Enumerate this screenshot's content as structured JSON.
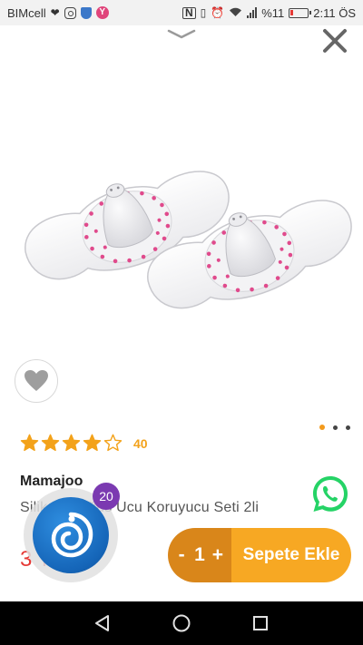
{
  "status_bar": {
    "carrier": "BIMcell",
    "battery_percent": "%11",
    "time": "2:11 ÖS",
    "icons": [
      "heart-icon",
      "instagram-icon",
      "shield-icon",
      "yandex-icon",
      "nfc-icon",
      "vibrate-icon",
      "alarm-icon",
      "wifi-icon",
      "signal-icon",
      "battery-icon"
    ]
  },
  "product": {
    "brand": "Mamajoo",
    "name": "Silikon Göğüs Ucu Koruyucu Seti 2li",
    "price": "3 TL",
    "rating": 4,
    "rating_max": 5,
    "review_count": "40",
    "image_count": 3,
    "active_image": 0
  },
  "chat": {
    "badge_count": "20"
  },
  "cart": {
    "minus_label": "-",
    "quantity": "1",
    "plus_label": "+",
    "add_label": "Sepete Ekle"
  },
  "colors": {
    "accent": "#f7a823",
    "accent_dark": "#d9861a",
    "price": "#e53935",
    "star": "#f3a21a",
    "whatsapp": "#25d366",
    "badge": "#7b3ab1"
  }
}
